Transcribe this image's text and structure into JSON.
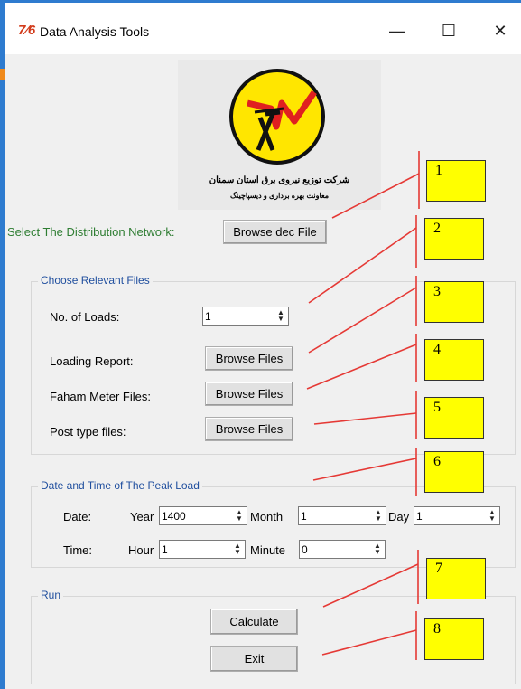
{
  "window": {
    "icon_text": "7⁄6",
    "title": "Data Analysis Tools",
    "minimize": "—",
    "maximize": "☐",
    "close": "✕"
  },
  "logo": {
    "line1": "شرکت توزیع نیروی برق استان سمنان",
    "line2": "معاونت بهره برداری و دیسپاچینگ"
  },
  "network": {
    "label": "Select The Distribution Network:",
    "button": "Browse dec File"
  },
  "relevant": {
    "title": "Choose Relevant Files",
    "loads_label": "No. of Loads:",
    "loads_value": "1",
    "loading_label": "Loading Report:",
    "loading_button": "Browse Files",
    "faham_label": "Faham Meter Files:",
    "faham_button": "Browse Files",
    "post_label": "Post type files:",
    "post_button": "Browse Files"
  },
  "peak": {
    "title": "Date and Time of The Peak Load",
    "date_label": "Date:",
    "year_label": "Year",
    "year_value": "1400",
    "month_label": "Month",
    "month_value": "1",
    "day_label": "Day",
    "day_value": "1",
    "time_label": "Time:",
    "hour_label": "Hour",
    "hour_value": "1",
    "minute_label": "Minute",
    "minute_value": "0"
  },
  "run": {
    "title": "Run",
    "calculate": "Calculate",
    "exit": "Exit"
  },
  "annotations": [
    "1",
    "2",
    "3",
    "4",
    "5",
    "6",
    "7",
    "8"
  ],
  "colors": {
    "annotation_fill": "#ffff00",
    "annotation_line": "#e53935",
    "label_green": "#2e7d32",
    "group_title_blue": "#1f4e9e"
  }
}
